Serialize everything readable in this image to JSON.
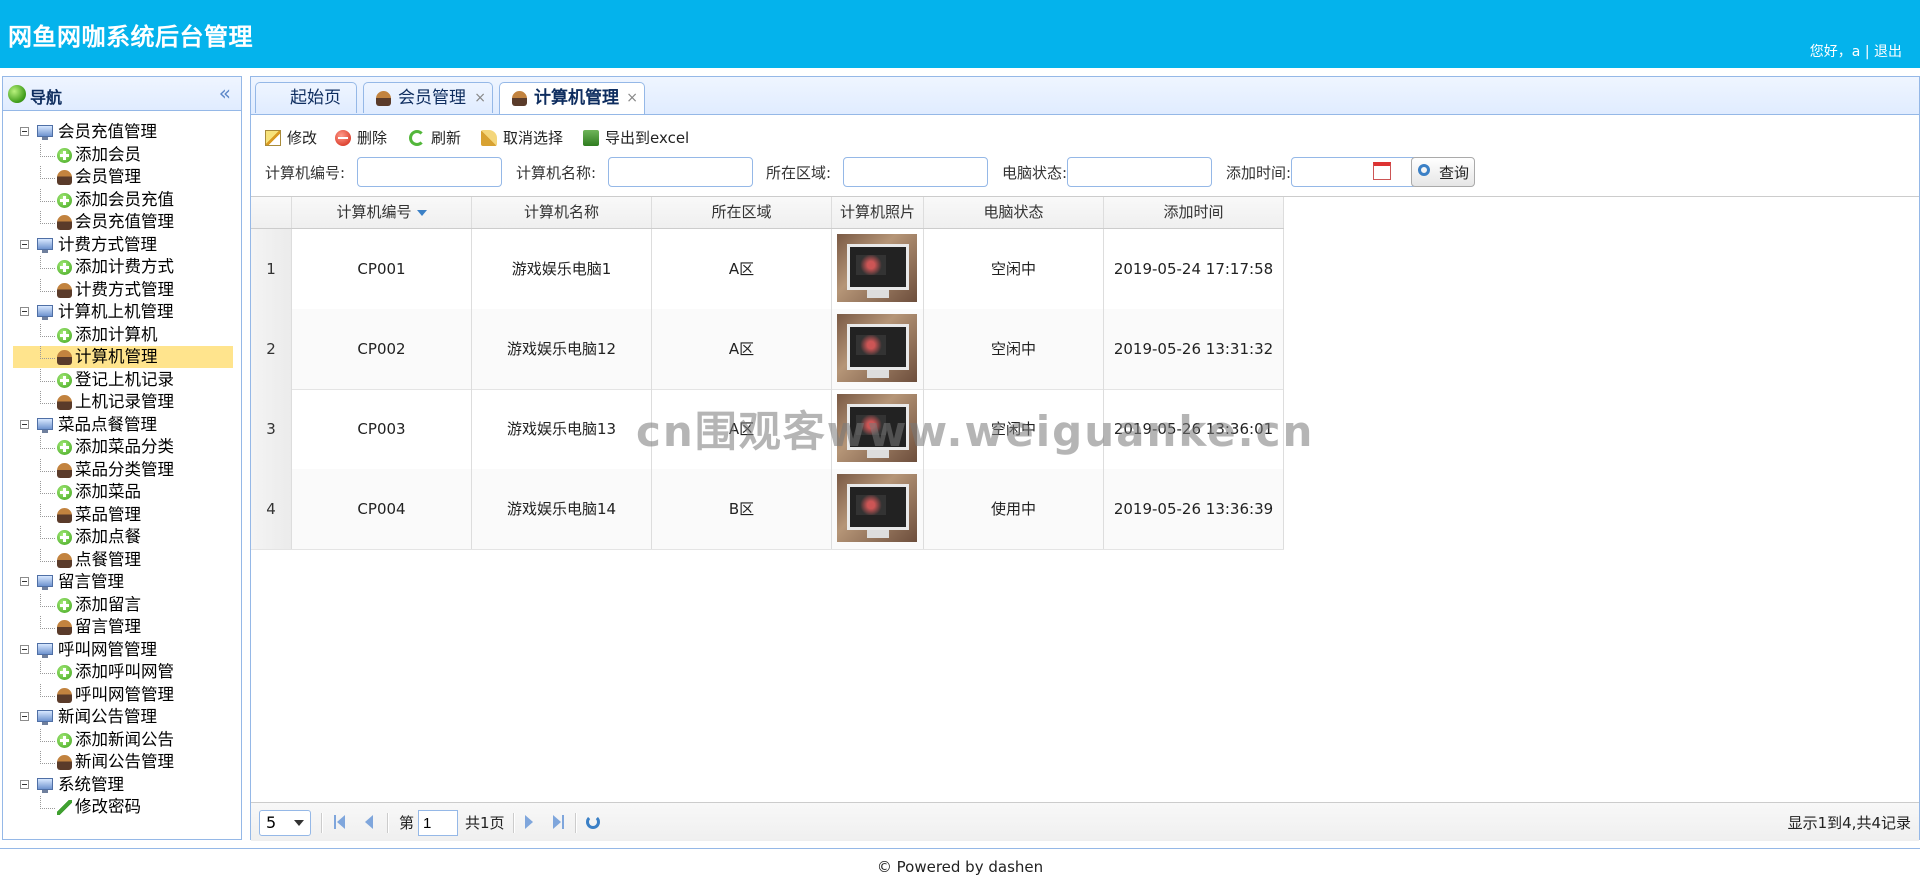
{
  "header": {
    "title": "网鱼网咖系统后台管理",
    "greeting": "您好，a",
    "divider": "|",
    "logout": "退出"
  },
  "sidebar": {
    "title": "导航",
    "collapse": "«",
    "groups": [
      {
        "label": "会员充值管理",
        "items": [
          "添加会员",
          "会员管理",
          "添加会员充值",
          "会员充值管理"
        ]
      },
      {
        "label": "计费方式管理",
        "items": [
          "添加计费方式",
          "计费方式管理"
        ]
      },
      {
        "label": "计算机上机管理",
        "items": [
          "添加计算机",
          "计算机管理",
          "登记上机记录",
          "上机记录管理"
        ]
      },
      {
        "label": "菜品点餐管理",
        "items": [
          "添加菜品分类",
          "菜品分类管理",
          "添加菜品",
          "菜品管理",
          "添加点餐",
          "点餐管理"
        ]
      },
      {
        "label": "留言管理",
        "items": [
          "添加留言",
          "留言管理"
        ]
      },
      {
        "label": "呼叫网管管理",
        "items": [
          "添加呼叫网管",
          "呼叫网管管理"
        ]
      },
      {
        "label": "新闻公告管理",
        "items": [
          "添加新闻公告",
          "新闻公告管理"
        ]
      },
      {
        "label": "系统管理",
        "items": [
          "修改密码"
        ]
      }
    ],
    "active_item": "计算机管理"
  },
  "tabs": [
    {
      "label": "起始页",
      "closable": false
    },
    {
      "label": "会员管理",
      "closable": true
    },
    {
      "label": "计算机管理",
      "closable": true,
      "selected": true
    }
  ],
  "tab_close": "×",
  "toolbar": {
    "edit": "修改",
    "delete": "删除",
    "refresh": "刷新",
    "unselect": "取消选择",
    "export": "导出到excel"
  },
  "filters": {
    "computer_no": "计算机编号:",
    "computer_name": "计算机名称:",
    "area": "所在区域:",
    "status": "电脑状态:",
    "add_time": "添加时间:",
    "query": "查询"
  },
  "table": {
    "columns": [
      "计算机编号",
      "计算机名称",
      "所在区域",
      "计算机照片",
      "电脑状态",
      "添加时间"
    ],
    "rows": [
      {
        "num": "1",
        "no": "CP001",
        "name": "游戏娱乐电脑1",
        "area": "A区",
        "status": "空闲中",
        "time": "2019-05-24 17:17:58"
      },
      {
        "num": "2",
        "no": "CP002",
        "name": "游戏娱乐电脑12",
        "area": "A区",
        "status": "空闲中",
        "time": "2019-05-26 13:31:32"
      },
      {
        "num": "3",
        "no": "CP003",
        "name": "游戏娱乐电脑13",
        "area": "A区",
        "status": "空闲中",
        "time": "2019-05-26 13:36:01"
      },
      {
        "num": "4",
        "no": "CP004",
        "name": "游戏娱乐电脑14",
        "area": "B区",
        "status": "使用中",
        "time": "2019-05-26 13:36:39"
      }
    ]
  },
  "pager": {
    "page_size": "5",
    "page_prefix": "第",
    "page_value": "1",
    "page_total": "共1页",
    "info": "显示1到4,共4记录"
  },
  "watermark": "cn围观客www.weiguanke.cn",
  "footer": "© Powered by dashen"
}
